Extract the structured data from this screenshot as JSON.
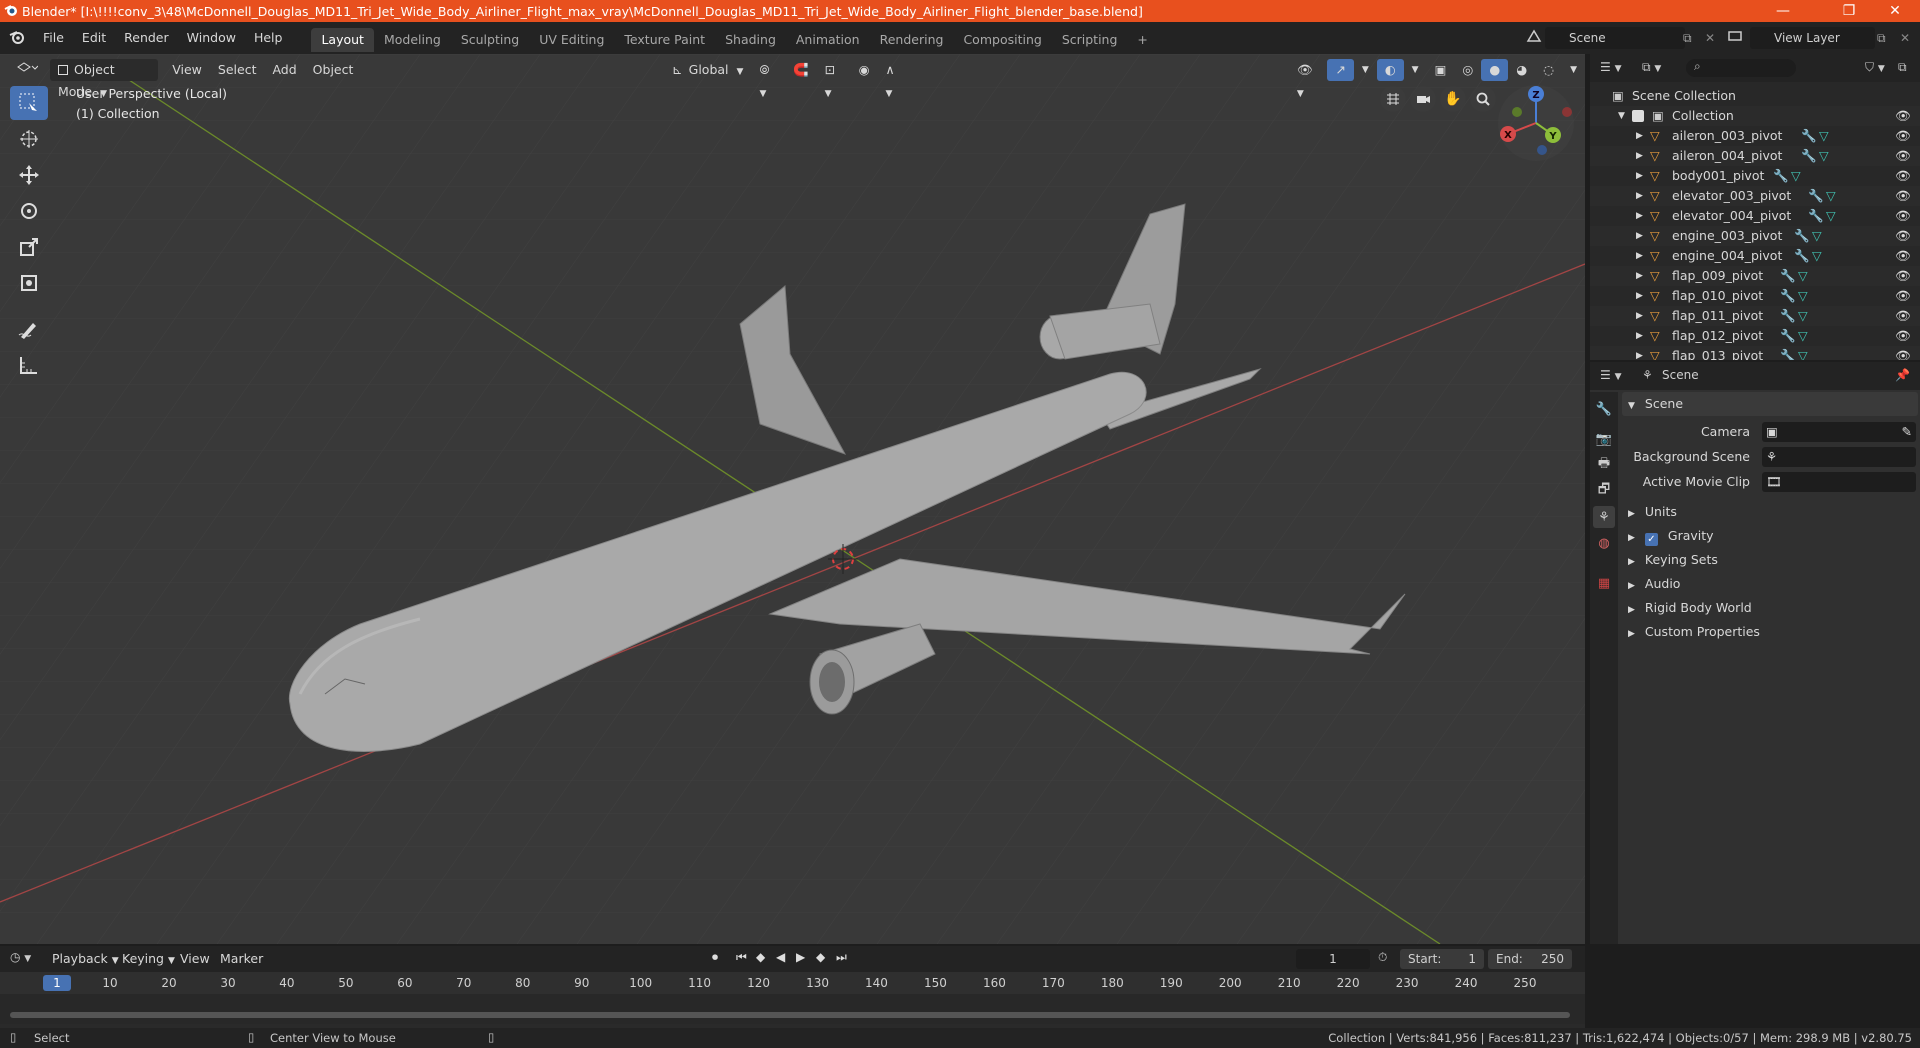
{
  "window": {
    "title": "Blender* [I:\\!!!!conv_3\\48\\McDonnell_Douglas_MD11_Tri_Jet_Wide_Body_Airliner_Flight_max_vray\\McDonnell_Douglas_MD11_Tri_Jet_Wide_Body_Airliner_Flight_blender_base.blend]",
    "minimize": "—",
    "maximize": "❐",
    "close": "✕"
  },
  "menu": {
    "items": [
      "File",
      "Edit",
      "Render",
      "Window",
      "Help"
    ]
  },
  "workspaces": {
    "tabs": [
      "Layout",
      "Modeling",
      "Sculpting",
      "UV Editing",
      "Texture Paint",
      "Shading",
      "Animation",
      "Rendering",
      "Compositing",
      "Scripting"
    ],
    "add": "+"
  },
  "scene": {
    "name": "Scene",
    "view_layer": "View Layer"
  },
  "viewport": {
    "mode": "Object Mode",
    "menus": [
      "View",
      "Select",
      "Add",
      "Object"
    ],
    "transform": "Global",
    "overlay_line1": "User Perspective (Local)",
    "overlay_line2": "(1) Collection",
    "gizmo": {
      "x": "X",
      "y": "Y",
      "z": "Z"
    }
  },
  "outliner": {
    "root": "Scene Collection",
    "collection": "Collection",
    "items": [
      "aileron_003_pivot",
      "aileron_004_pivot",
      "body001_pivot",
      "elevator_003_pivot",
      "elevator_004_pivot",
      "engine_003_pivot",
      "engine_004_pivot",
      "flap_009_pivot",
      "flap_010_pivot",
      "flap_011_pivot",
      "flap_012_pivot",
      "flap_013_pivot"
    ]
  },
  "properties": {
    "header": "Scene",
    "panel_title": "Scene",
    "fields": [
      {
        "label": "Camera"
      },
      {
        "label": "Background Scene"
      },
      {
        "label": "Active Movie Clip"
      }
    ],
    "sections": [
      "Units",
      "Gravity",
      "Keying Sets",
      "Audio",
      "Rigid Body World",
      "Custom Properties"
    ],
    "gravity_checked": true
  },
  "timeline": {
    "menus": [
      "Playback",
      "Keying",
      "View",
      "Marker"
    ],
    "current_frame": "1",
    "start_label": "Start:",
    "start": "1",
    "end_label": "End:",
    "end": "250",
    "ruler": [
      "1",
      "10",
      "20",
      "30",
      "40",
      "50",
      "60",
      "70",
      "80",
      "90",
      "100",
      "110",
      "120",
      "130",
      "140",
      "150",
      "160",
      "170",
      "180",
      "190",
      "200",
      "210",
      "220",
      "230",
      "240",
      "250"
    ]
  },
  "statusbar": {
    "left": "Select",
    "middle": "Center View to Mouse",
    "stats": "Collection | Verts:841,956 | Faces:811,237 | Tris:1,622,474 | Objects:0/57 | Mem: 298.9 MB | v2.80.75"
  },
  "colors": {
    "accent": "#4772b3",
    "titlebar": "#e8501e",
    "object_icon": "#e59a3c",
    "mesh_icon": "#40c0b0",
    "modifier_icon": "#6aa0e0"
  }
}
